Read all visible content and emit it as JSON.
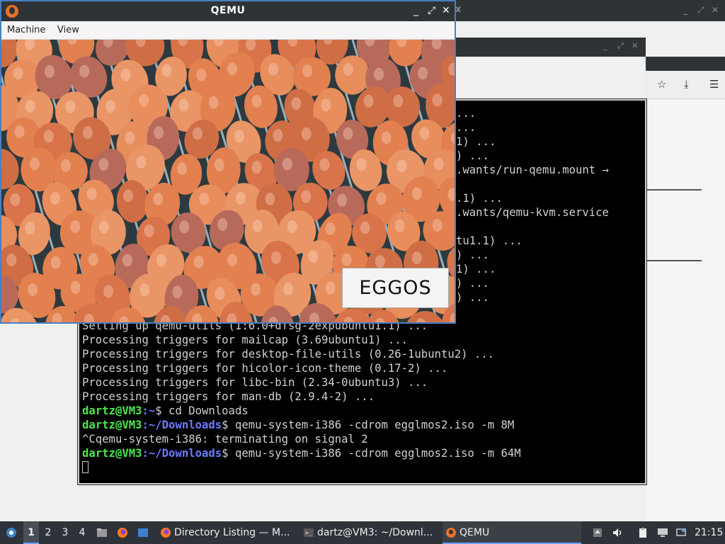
{
  "qemu_window": {
    "title": "QEMU",
    "menu": [
      "Machine",
      "View"
    ],
    "controls": [
      "_",
      "⤢",
      "✕"
    ],
    "guest_sign_text": "EGGOS"
  },
  "background_windows": {
    "back_close_glyph": "x",
    "back_controls": [
      "_",
      "⤢",
      "✕"
    ],
    "browser_controls": [
      "_",
      "⤢",
      "✕"
    ],
    "browser_nav_icons": [
      "star-icon",
      "download-icon",
      "menu-icon"
    ]
  },
  "terminal": {
    "visible_right_fragments": [
      "...",
      "...",
      "1) ...",
      ") ...",
      ".wants/run-qemu.mount →",
      "",
      ".1) ...",
      ".wants/qemu-kvm.service",
      "",
      "tu1.1) ...",
      ") ...",
      "1) ...",
      ") ...",
      ") ..."
    ],
    "lines": [
      {
        "text": "Setting up qemu-utils (1:6.0+dfsg-2expubuntu1.1) ..."
      },
      {
        "text": "Processing triggers for mailcap (3.69ubuntu1) ..."
      },
      {
        "text": "Processing triggers for desktop-file-utils (0.26-1ubuntu2) ..."
      },
      {
        "text": "Processing triggers for hicolor-icon-theme (0.17-2) ..."
      },
      {
        "text": "Processing triggers for libc-bin (2.34-0ubuntu3) ..."
      },
      {
        "text": "Processing triggers for man-db (2.9.4-2) ..."
      },
      {
        "user": "dartz@VM3",
        "path": ":~",
        "cmd": "$ cd Downloads"
      },
      {
        "user": "dartz@VM3",
        "path": ":~/Downloads",
        "cmd": "$ qemu-system-i386 -cdrom egglmos2.iso -m 8M"
      },
      {
        "text": "^Cqemu-system-i386: terminating on signal 2"
      },
      {
        "user": "dartz@VM3",
        "path": ":~/Downloads",
        "cmd": "$ qemu-system-i386 -cdrom egglmos2.iso -m 64M"
      }
    ]
  },
  "taskbar": {
    "workspaces": [
      "1",
      "2",
      "3",
      "4"
    ],
    "active_workspace": "1",
    "tasks": [
      {
        "label": "Directory Listing — M...",
        "icon": "firefox-icon"
      },
      {
        "label": "dartz@VM3: ~/Downl...",
        "icon": "terminal-icon"
      },
      {
        "label": "QEMU",
        "icon": "qemu-icon"
      }
    ],
    "clock": "21:15"
  },
  "colors": {
    "titlebar": "#2e3436",
    "taskbar": "#2d3338",
    "prompt_user": "#4ae84a",
    "prompt_path": "#6b7cff",
    "qemu_border": "#4a7fc1",
    "egg": "#e07a4a"
  }
}
